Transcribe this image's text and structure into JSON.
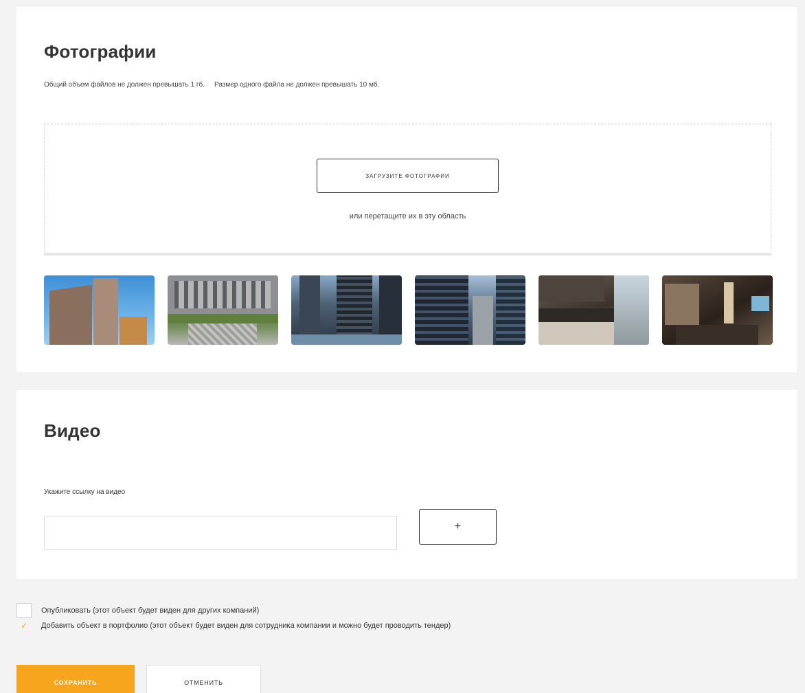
{
  "photos": {
    "title": "Фотографии",
    "hint_total": "Общий объем файлов не должен превышать 1 гб.",
    "hint_single": "Размер одного файла не должен превышать 10 мб.",
    "upload_label": "ЗАГРУЗИТЕ ФОТОГРАФИИ",
    "drop_hint": "или перетащите их в эту область",
    "thumbnails": [
      "photo-1",
      "photo-2",
      "photo-3",
      "photo-4",
      "photo-5",
      "photo-6"
    ]
  },
  "video": {
    "title": "Видео",
    "link_label": "Укажите ссылку на видео",
    "link_value": "",
    "link_placeholder": "",
    "add_label": "+"
  },
  "options": {
    "publish_label": "Опубликовать (этот объект будет виден для других компаний)",
    "publish_checked": false,
    "portfolio_label": "Добавить объект в портфолио (этот объект будет виден для сотрудника компании и можно будет проводить тендер)",
    "portfolio_checked": true,
    "check_glyph": "✓"
  },
  "actions": {
    "save_label": "СОХРАНИТЬ",
    "cancel_label": "ОТМЕНИТЬ"
  },
  "colors": {
    "accent": "#f7a51c",
    "background": "#f3f3f3",
    "card": "#ffffff",
    "text": "#333333"
  },
  "icons": {
    "add": "plus-icon",
    "checked": "checkmark-icon"
  }
}
